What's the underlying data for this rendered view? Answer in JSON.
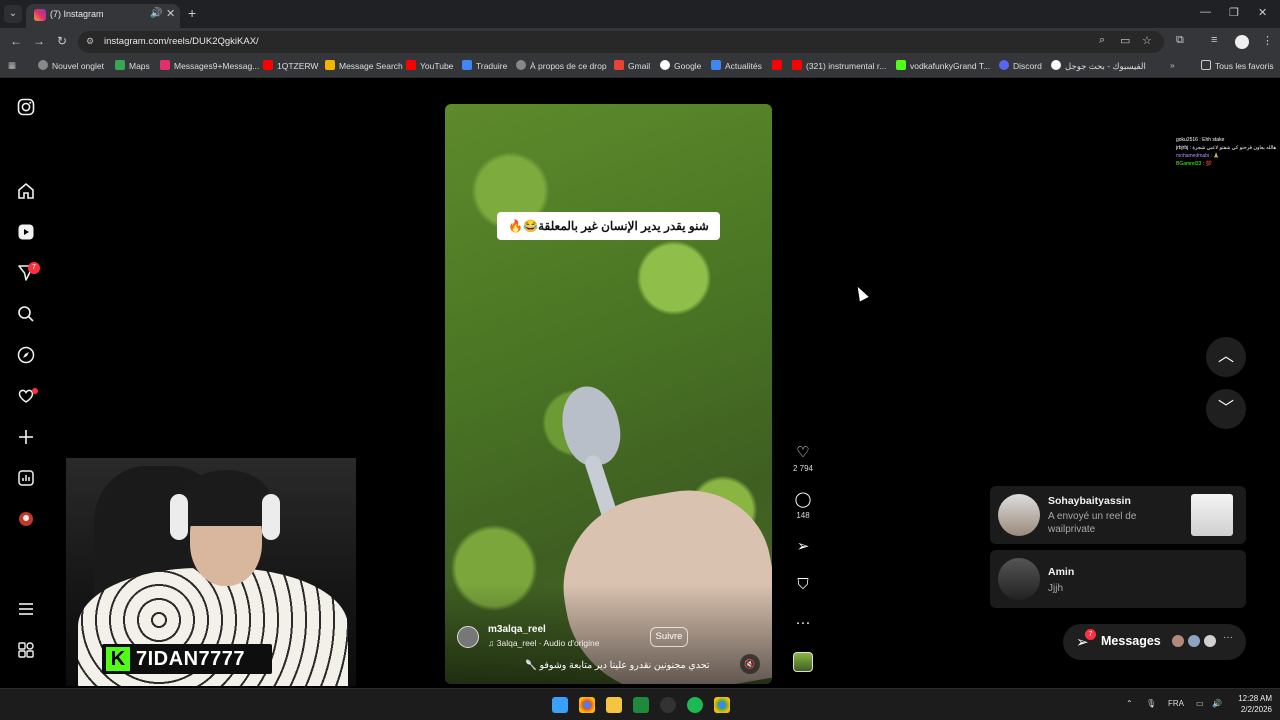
{
  "browser": {
    "tab_title": "(7) Instagram",
    "url": "instagram.com/reels/DUK2QgkiKAX/",
    "bookmarks": [
      "Nouvel onglet",
      "Maps",
      "Messages9+Messag...",
      "1QTZERW",
      "Message Search",
      "YouTube",
      "Traduire",
      "À propos de ce drop",
      "Gmail",
      "Google",
      "Actualités",
      "(321) instrumental r...",
      "vodkafunkyGrand T...",
      "Discord",
      "الفيسبوك - بحث جوجل"
    ],
    "all_favorites": "Tous les favoris"
  },
  "instagram": {
    "nav_badge_count": "7",
    "reel": {
      "overlay_caption": "شنو يقدر يدير الإنسان غير بالمعلقة😂🔥",
      "username": "m3alqa_reel",
      "audio": "3alqa_reel · Audio d'origine",
      "follow_label": "Suivre",
      "description": "تحدي مجنونين نقدرو علينا دير متابعة وشوفو 🥄",
      "likes": "2 794",
      "comments": "148"
    },
    "messages": [
      {
        "name": "Sohaybaityassin",
        "text": "A envoyé un reel de wailprivate"
      },
      {
        "name": "Amin",
        "text": "Jjjh"
      }
    ],
    "messages_label": "Messages",
    "messages_badge": "7"
  },
  "stream_overlay": {
    "streamer_name": "7IDAN7777",
    "chat_lines": [
      "goku2516 : Ehh stake",
      "jrbjrbj : هالله يعاون فرحتو كي شفتو لاعبي شجرة",
      "mohamedmabi : 🙏",
      "BGamrel33 : 💯"
    ]
  },
  "taskbar": {
    "language": "FRA",
    "time": "12:28 AM",
    "date": "2/2/2026"
  },
  "colors": {
    "accent_red": "#ff3040",
    "kick_green": "#53fc18"
  }
}
